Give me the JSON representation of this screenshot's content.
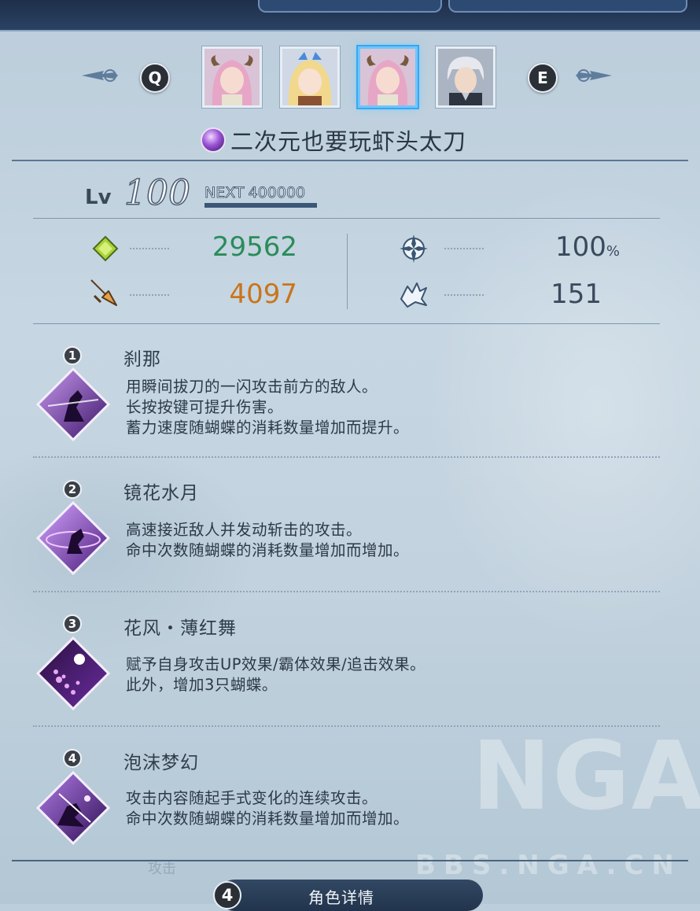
{
  "selector": {
    "prev_key": "Q",
    "next_key": "E",
    "portraits": [
      {
        "name": "portrait-narmaya",
        "selected": false
      },
      {
        "name": "portrait-io",
        "selected": false
      },
      {
        "name": "portrait-narmaya",
        "selected": true
      },
      {
        "name": "portrait-silver-haired-male",
        "selected": false
      }
    ]
  },
  "character": {
    "name": "二次元也要玩虾头太刀",
    "level_label": "Lv",
    "level": "100",
    "next_label": "NEXT",
    "next_value": "400000"
  },
  "stats": {
    "hp": "29562",
    "attack": "4097",
    "crit_rate": "100",
    "crit_rate_unit": "%",
    "stun": "151",
    "colors": {
      "hp": "#2a8c5a",
      "attack": "#c9751b",
      "neutral": "#3a4a5c"
    }
  },
  "skills": [
    {
      "num": "1",
      "name": "刹那",
      "desc": [
        "用瞬间拔刀的一闪攻击前方的敌人。",
        "长按按键可提升伤害。",
        "蓄力速度随蝴蝶的消耗数量增加而提升。"
      ]
    },
    {
      "num": "2",
      "name": "镜花水月",
      "desc": [
        "高速接近敌人并发动斩击的攻击。",
        "命中次数随蝴蝶的消耗数量增加而增加。"
      ]
    },
    {
      "num": "3",
      "name": "花风・薄红舞",
      "desc": [
        "赋予自身攻击UP效果/霸体效果/追击效果。",
        "此外，增加3只蝴蝶。"
      ]
    },
    {
      "num": "4",
      "name": "泡沫梦幻",
      "desc": [
        "攻击内容随起手式变化的连续攻击。",
        "命中次数随蝴蝶的消耗数量增加而增加。"
      ]
    }
  ],
  "bottom": {
    "tab_num": "4",
    "tab_label": "角色详情",
    "ghost_label": "攻击"
  },
  "watermark": {
    "logo": "NGA",
    "site": "BBS.NGA.CN"
  }
}
